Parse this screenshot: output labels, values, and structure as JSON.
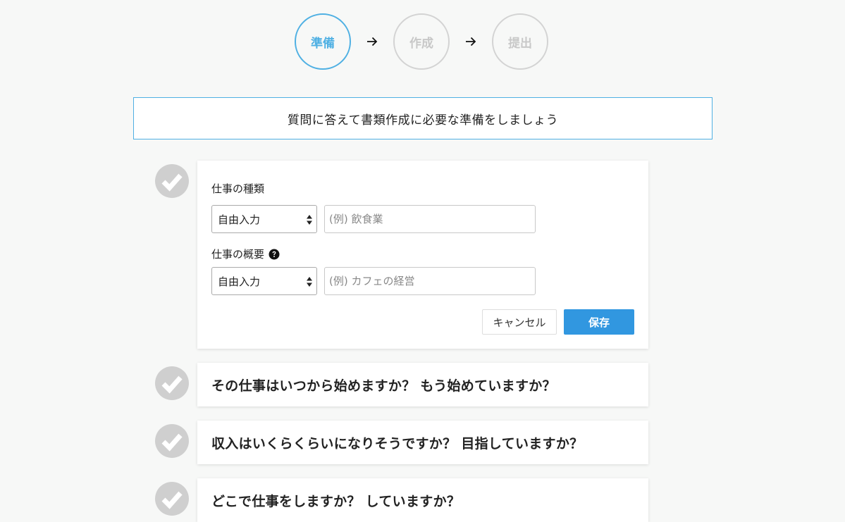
{
  "steps": [
    {
      "label": "準備",
      "active": true
    },
    {
      "label": "作成",
      "active": false
    },
    {
      "label": "提出",
      "active": false
    }
  ],
  "banner": {
    "text": "質問に答えて書類作成に必要な準備をしましょう"
  },
  "form": {
    "job_type": {
      "label": "仕事の種類",
      "select_value": "自由入力",
      "input_placeholder": "(例) 飲食業"
    },
    "job_summary": {
      "label": "仕事の概要",
      "select_value": "自由入力",
      "input_placeholder": "(例) カフェの経営"
    },
    "cancel_label": "キャンセル",
    "save_label": "保存"
  },
  "questions": [
    {
      "text": "その仕事はいつから始めますか？ もう始めていますか？"
    },
    {
      "text": "収入はいくらくらいになりそうですか？ 目指していますか？"
    },
    {
      "text": "どこで仕事をしますか？ していますか？"
    }
  ],
  "colors": {
    "accent": "#4fb0e3",
    "primary_button": "#3197e0",
    "check_gray": "#cfcfcf",
    "background": "#f7f8f7"
  },
  "icons": {
    "step_arrow": "arrow-right-icon",
    "check": "check-circle-icon",
    "help": "question-circle-icon",
    "select_spinner": "updown-arrows-icon"
  }
}
